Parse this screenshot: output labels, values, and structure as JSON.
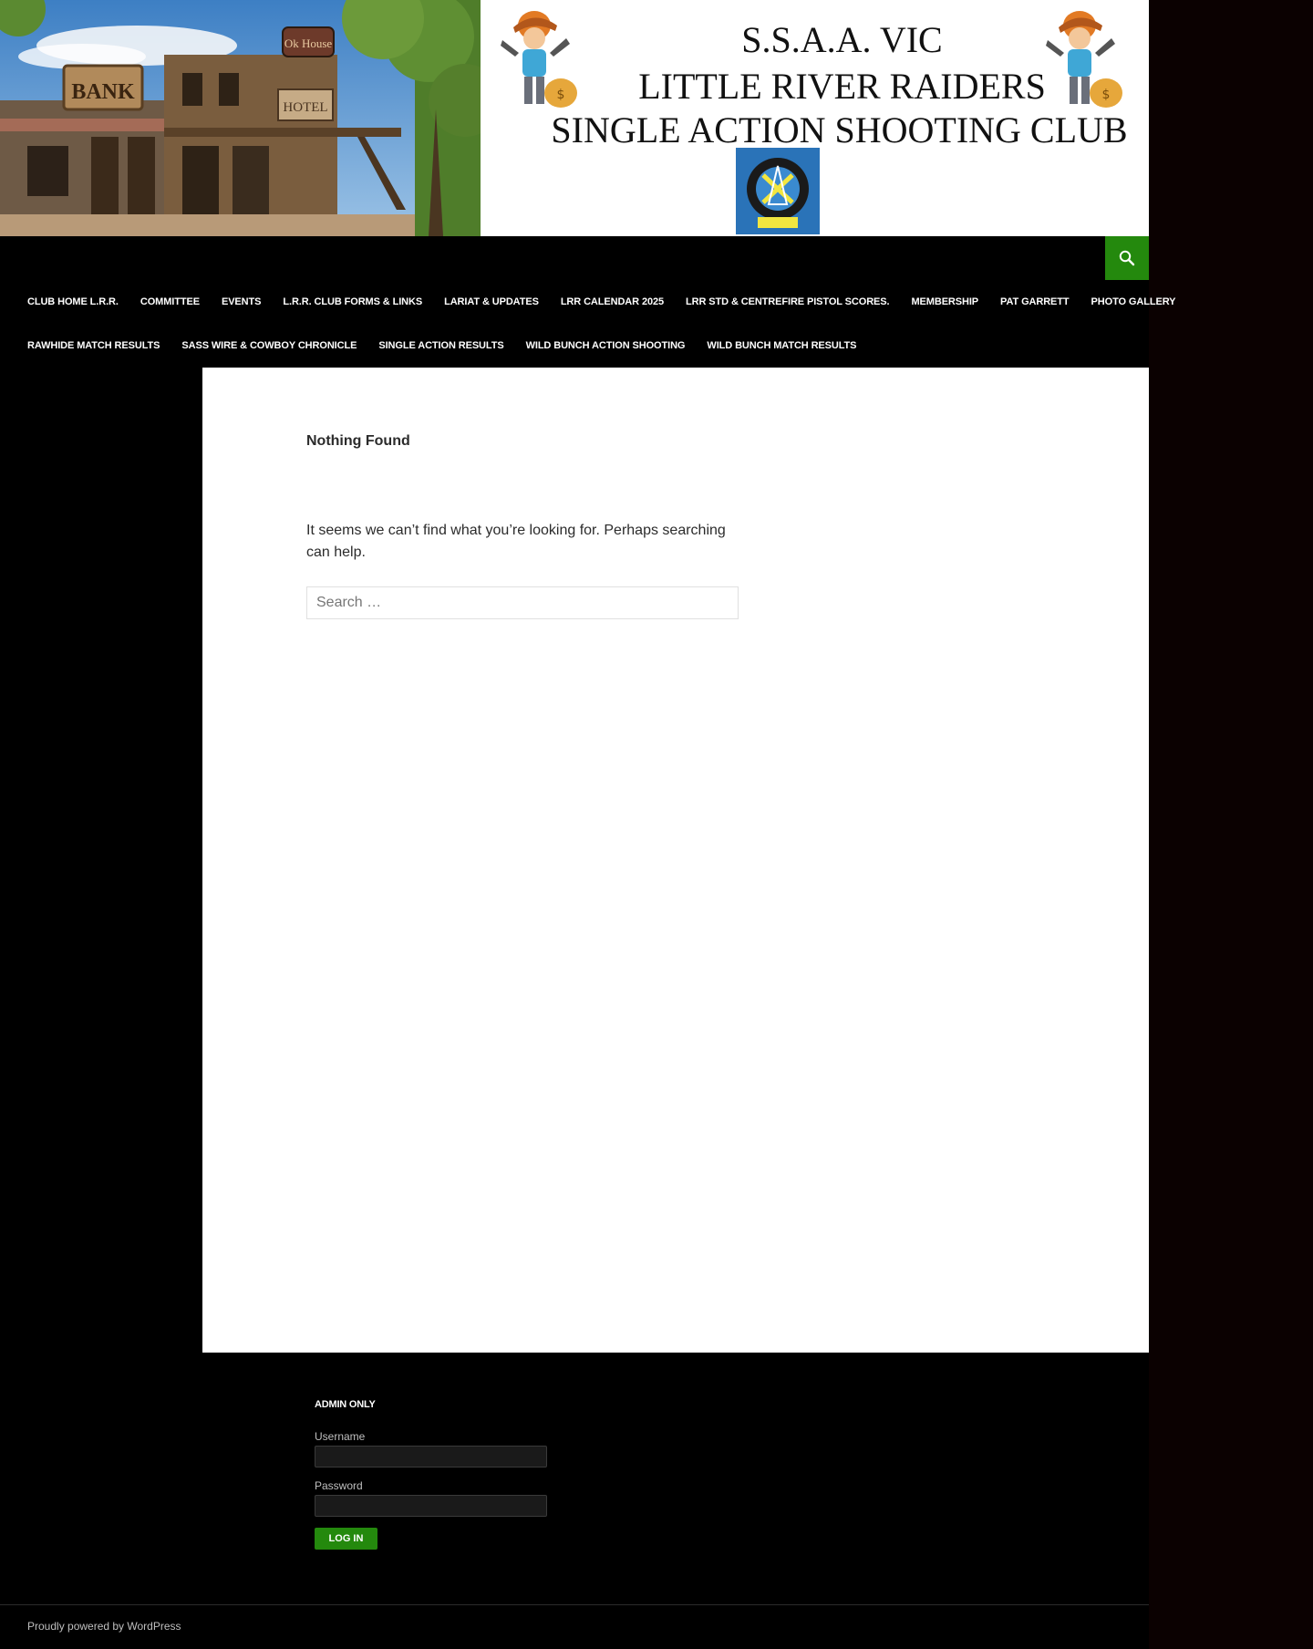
{
  "header": {
    "banner_lines": [
      "S.S.A.A. VIC",
      "LITTLE RIVER RAIDERS",
      "SINGLE ACTION SHOOTING CLUB"
    ],
    "photo_signs": {
      "bank": "BANK",
      "hotel": "HOTEL",
      "saloon": "Ok House"
    },
    "accent_color": "#24890d"
  },
  "nav": {
    "row_1": [
      "CLUB HOME L.R.R.",
      "COMMITTEE",
      "EVENTS",
      "L.R.R. CLUB FORMS & LINKS",
      "LARIAT & UPDATES",
      "LRR CALENDAR 2025",
      "LRR STD & CENTREFIRE PISTOL SCORES.",
      "MEMBERSHIP",
      "PAT GARRETT",
      "PHOTO GALLERY"
    ],
    "row_2": [
      "RAWHIDE MATCH RESULTS",
      "SASS WIRE & COWBOY CHRONICLE",
      "SINGLE ACTION RESULTS",
      "WILD BUNCH ACTION SHOOTING",
      "WILD BUNCH MATCH RESULTS"
    ],
    "search_icon": "search-icon"
  },
  "main": {
    "title": "Nothing Found",
    "message": "It seems we can’t find what you’re looking for. Perhaps searching can help.",
    "search_placeholder": "Search …"
  },
  "footer": {
    "widget_title": "ADMIN ONLY",
    "username_label": "Username",
    "password_label": "Password",
    "login_label": "LOG IN",
    "powered_by": "Proudly powered by WordPress"
  }
}
